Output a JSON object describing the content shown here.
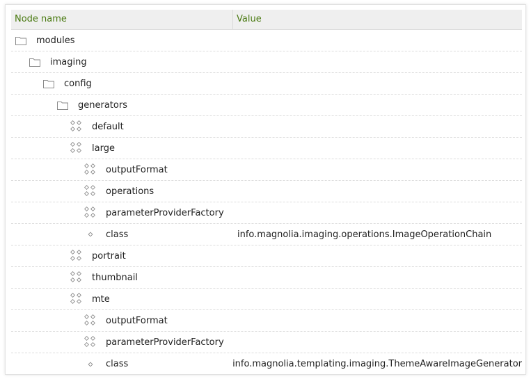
{
  "header": {
    "node_name_label": "Node name",
    "value_label": "Value"
  },
  "rows": [
    {
      "label": "modules",
      "depth": 0,
      "type": "folder",
      "value": ""
    },
    {
      "label": "imaging",
      "depth": 1,
      "type": "folder",
      "value": ""
    },
    {
      "label": "config",
      "depth": 2,
      "type": "folder",
      "value": ""
    },
    {
      "label": "generators",
      "depth": 3,
      "type": "folder",
      "value": ""
    },
    {
      "label": "default",
      "depth": 4,
      "type": "content-node",
      "value": ""
    },
    {
      "label": "large",
      "depth": 4,
      "type": "content-node",
      "value": ""
    },
    {
      "label": "outputFormat",
      "depth": 5,
      "type": "content-node",
      "value": ""
    },
    {
      "label": "operations",
      "depth": 5,
      "type": "content-node",
      "value": ""
    },
    {
      "label": "parameterProviderFactory",
      "depth": 5,
      "type": "content-node",
      "value": ""
    },
    {
      "label": "class",
      "depth": 5,
      "type": "property",
      "value": "info.magnolia.imaging.operations.ImageOperationChain"
    },
    {
      "label": "portrait",
      "depth": 4,
      "type": "content-node",
      "value": ""
    },
    {
      "label": "thumbnail",
      "depth": 4,
      "type": "content-node",
      "value": ""
    },
    {
      "label": "mte",
      "depth": 4,
      "type": "content-node",
      "value": ""
    },
    {
      "label": "outputFormat",
      "depth": 5,
      "type": "content-node",
      "value": ""
    },
    {
      "label": "parameterProviderFactory",
      "depth": 5,
      "type": "content-node",
      "value": ""
    },
    {
      "label": "class",
      "depth": 5,
      "type": "property",
      "value": "info.magnolia.templating.imaging.ThemeAwareImageGenerator"
    }
  ],
  "icons": {
    "folder": "folder-icon",
    "content-node": "content-node-icon",
    "property": "property-icon"
  },
  "colors": {
    "header_text": "#4a7a12",
    "header_bg": "#efefef",
    "icon_stroke": "#8a8a8a"
  }
}
